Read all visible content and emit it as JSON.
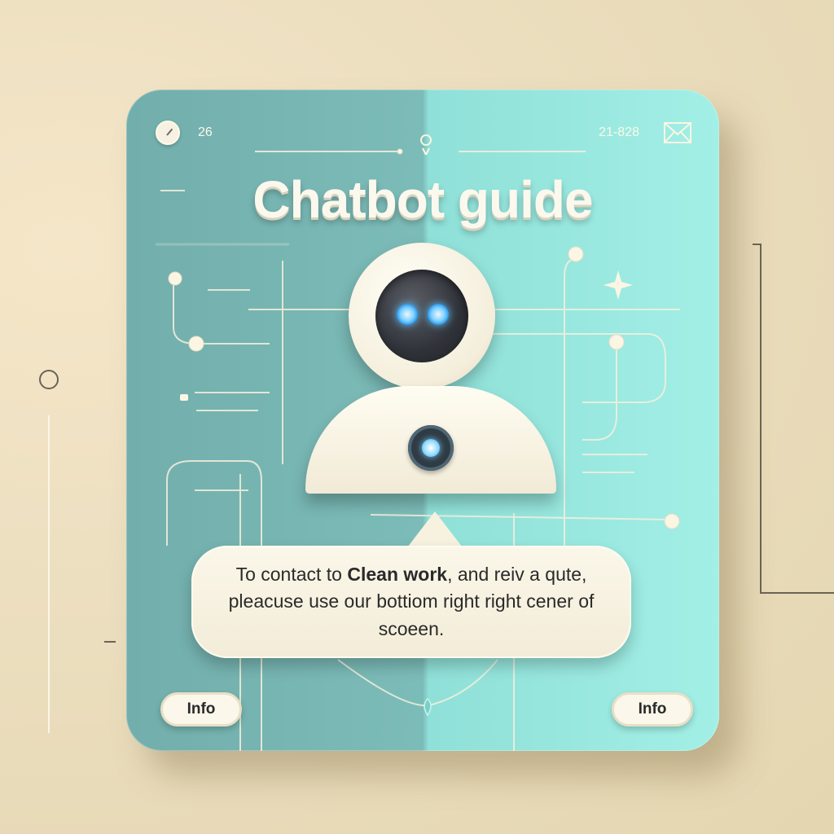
{
  "header": {
    "left_value": "26",
    "right_value": "21-828"
  },
  "title": "Chatbot guide",
  "bubble": {
    "prefix": "To contact to ",
    "bold": "Clean work",
    "suffix": ", and reiv a qute, pleacuse use our bottiom right right cener of scoeen."
  },
  "buttons": {
    "info_left": "Info",
    "info_right": "Info"
  },
  "colors": {
    "card_left": "#72aeac",
    "card_right": "#a2efe6",
    "background": "#ecdfc0",
    "bubble": "#fbf7e9"
  },
  "icons": [
    "clock-icon",
    "mail-icon",
    "location-pin-icon",
    "sparkle-icon",
    "robot-avatar"
  ]
}
